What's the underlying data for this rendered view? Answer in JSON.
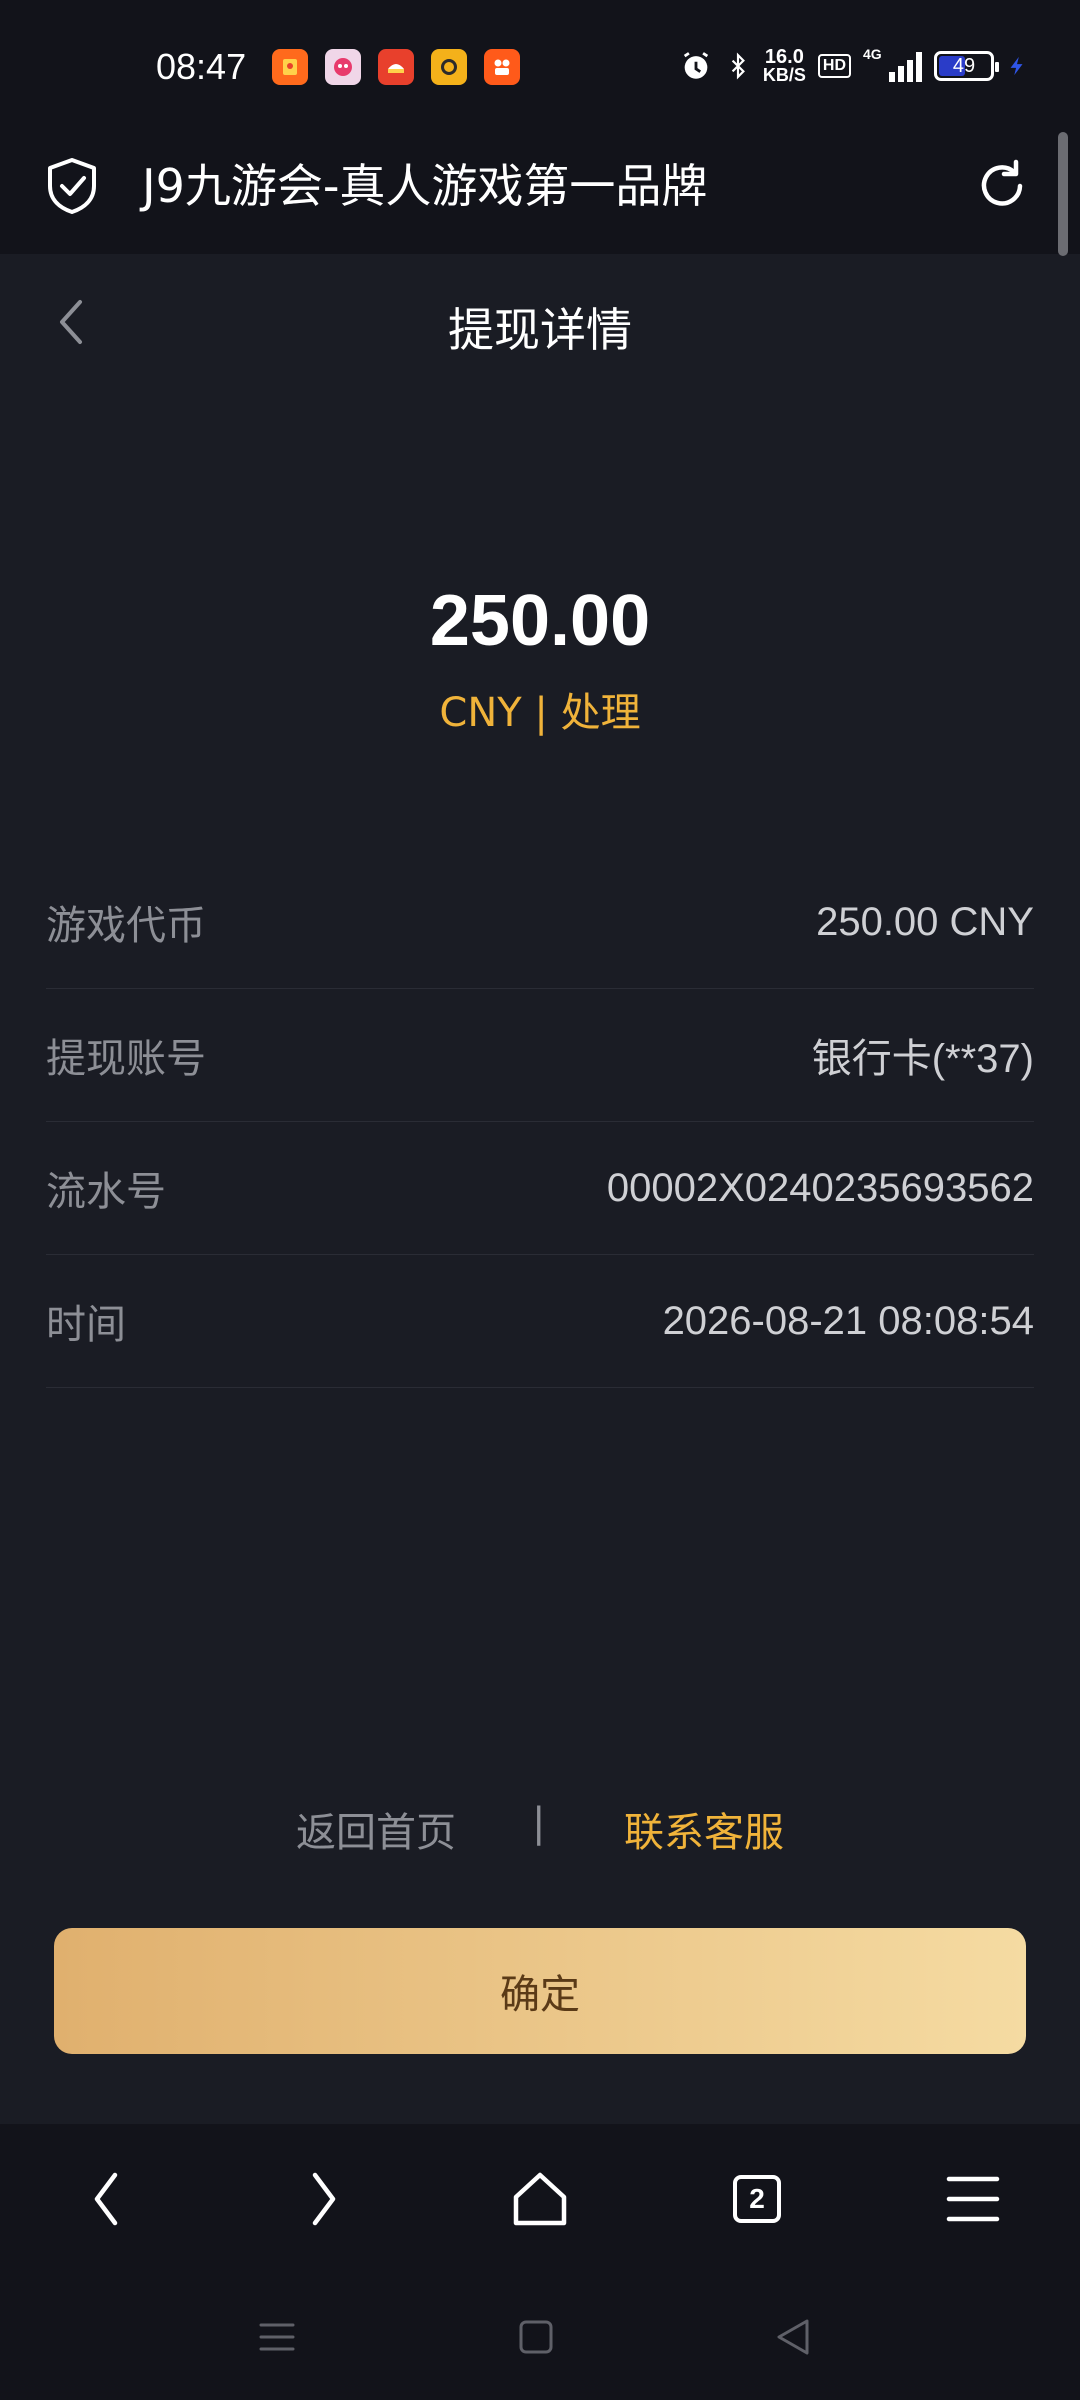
{
  "status_bar": {
    "time": "08:47",
    "app_icons": [
      "red-packet-app-icon",
      "618-promo-app-icon",
      "red-app-icon",
      "yellow-app-icon",
      "kuaishou-app-icon"
    ],
    "net_speed_value": "16.0",
    "net_speed_unit": "KB/S",
    "hd_label": "HD",
    "network_label": "4G",
    "battery_level": "49"
  },
  "browser": {
    "title": "J9九游会-真人游戏第一品牌"
  },
  "page": {
    "title": "提现详情",
    "amount": "250.00",
    "status": "CNY | 处理"
  },
  "details": [
    {
      "label": "游戏代币",
      "value": "250.00 CNY"
    },
    {
      "label": "提现账号",
      "value": "银行卡(**37)"
    },
    {
      "label": "流水号",
      "value": "00002X0240235693562"
    },
    {
      "label": "时间",
      "value": "2026-08-21 08:08:54"
    }
  ],
  "links": {
    "home": "返回首页",
    "separator": "|",
    "support": "联系客服"
  },
  "confirm_button": "确定",
  "browser_nav": {
    "tab_count": "2"
  },
  "colors": {
    "background": "#1a1c24",
    "bar_background": "#12131a",
    "accent": "#f0b33a",
    "button_gradient_start": "#e0b06e",
    "button_gradient_end": "#f5dba2"
  }
}
